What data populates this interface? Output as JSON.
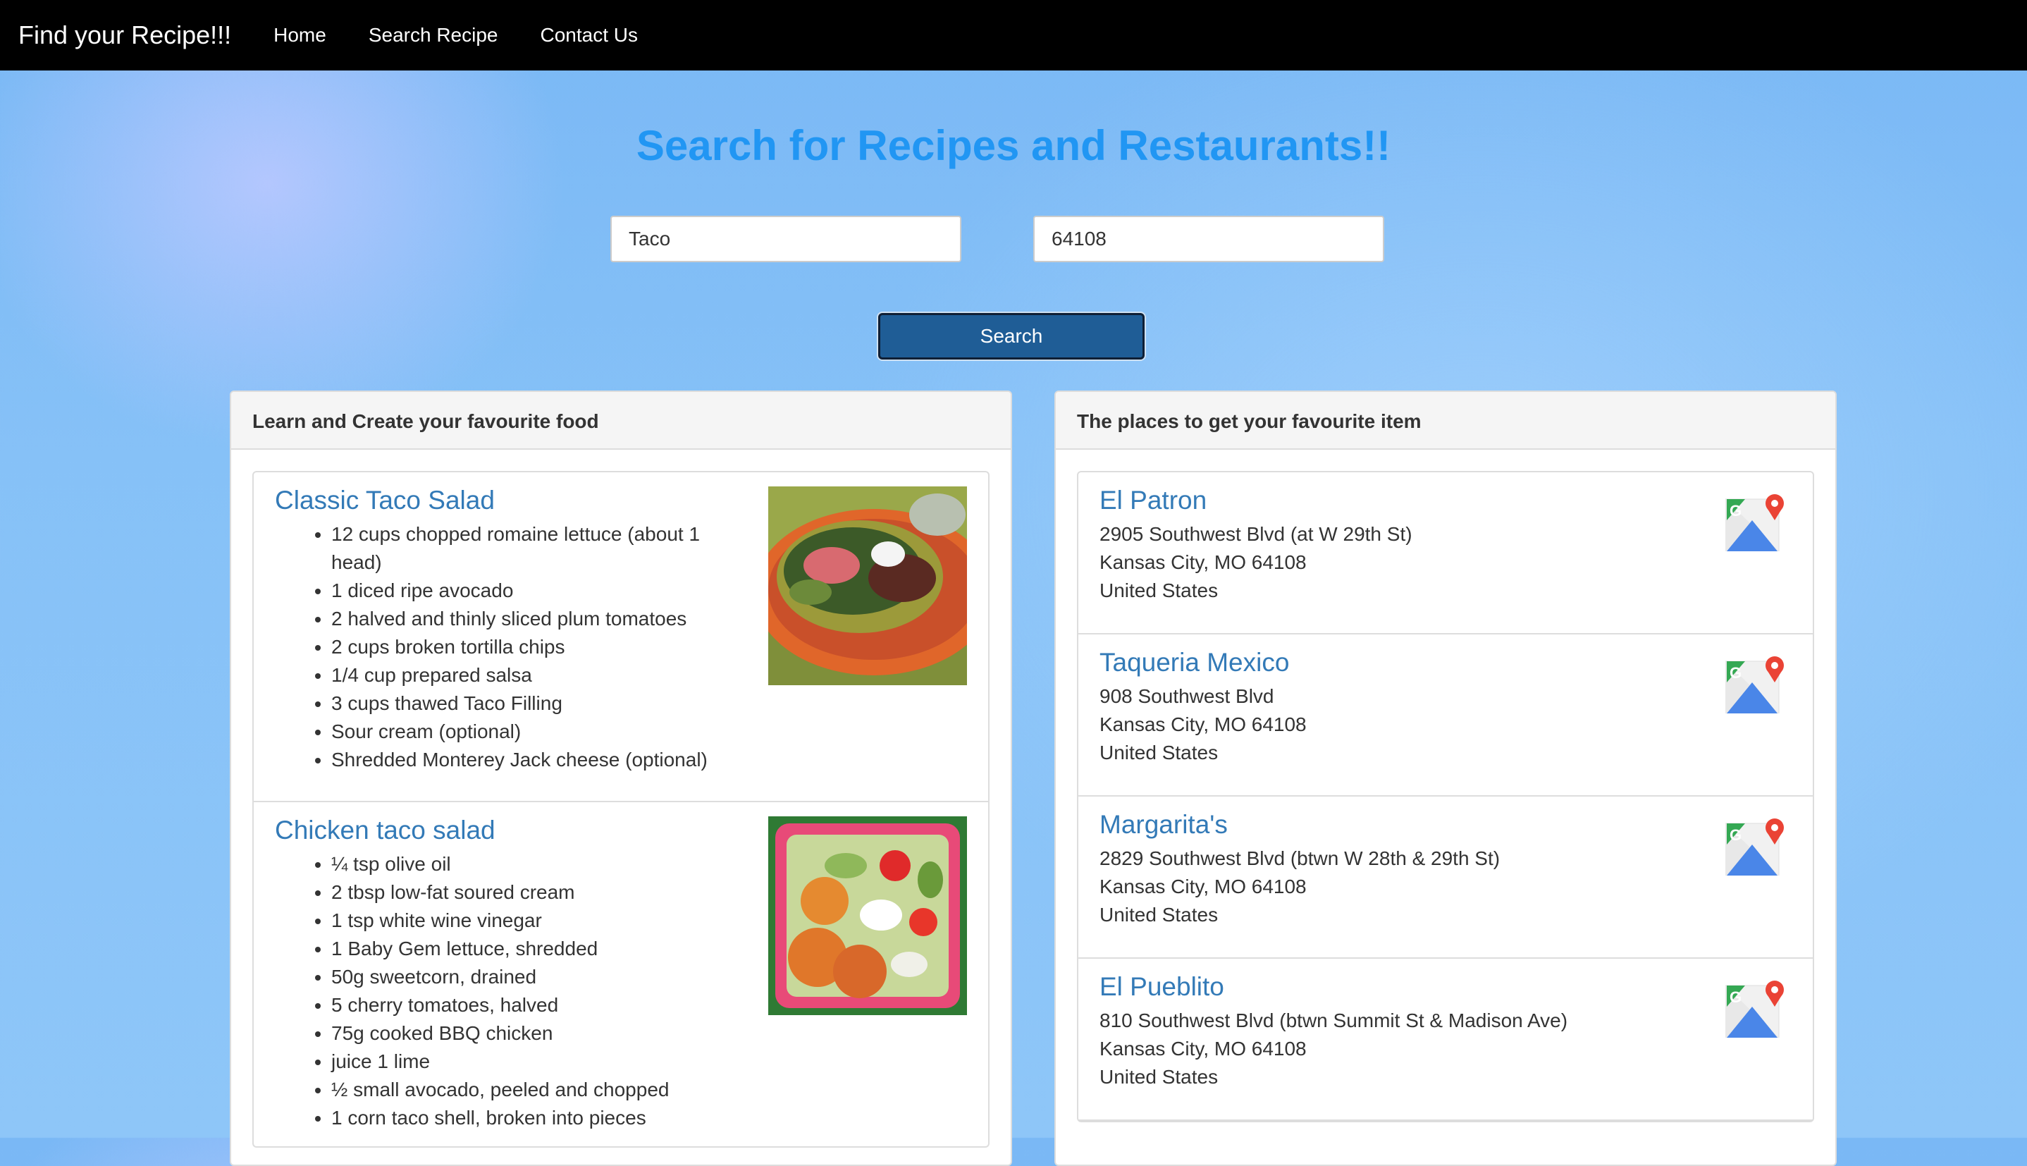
{
  "nav": {
    "brand": "Find your Recipe!!!",
    "links": [
      "Home",
      "Search Recipe",
      "Contact Us"
    ]
  },
  "search": {
    "heading": "Search for Recipes and Restaurants!!",
    "query_value": "Taco",
    "zip_value": "64108",
    "button_label": "Search"
  },
  "recipes_panel": {
    "title": "Learn and Create your favourite food",
    "recipes": [
      {
        "name": "Classic Taco Salad",
        "ingredients": [
          "12 cups chopped romaine lettuce (about 1 head)",
          "1 diced ripe avocado",
          "2 halved and thinly sliced plum tomatoes",
          "2 cups broken tortilla chips",
          "1/4 cup prepared salsa",
          "3 cups thawed Taco Filling",
          "Sour cream (optional)",
          "Shredded Monterey Jack cheese (optional)"
        ]
      },
      {
        "name": "Chicken taco salad",
        "ingredients": [
          "¼ tsp olive oil",
          "2 tbsp low-fat soured cream",
          "1 tsp white wine vinegar",
          "1 Baby Gem lettuce, shredded",
          "50g sweetcorn, drained",
          "5 cherry tomatoes, halved",
          "75g cooked BBQ chicken",
          "juice 1 lime",
          "½ small avocado, peeled and chopped",
          "1 corn taco shell, broken into pieces"
        ]
      }
    ]
  },
  "places_panel": {
    "title": "The places to get your favourite item",
    "places": [
      {
        "name": "El Patron",
        "street": "2905 Southwest Blvd (at W 29th St)",
        "city": "Kansas City, MO 64108",
        "country": "United States",
        "icon": "google-maps-icon"
      },
      {
        "name": "Taqueria Mexico",
        "street": "908 Southwest Blvd",
        "city": "Kansas City, MO 64108",
        "country": "United States",
        "icon": "google-maps-icon"
      },
      {
        "name": "Margarita's",
        "street": "2829 Southwest Blvd (btwn W 28th & 29th St)",
        "city": "Kansas City, MO 64108",
        "country": "United States",
        "icon": "google-maps-icon"
      },
      {
        "name": "El Pueblito",
        "street": "810 Southwest Blvd (btwn Summit St & Madison Ave)",
        "city": "Kansas City, MO 64108",
        "country": "United States",
        "icon": "google-maps-icon"
      }
    ]
  },
  "colors": {
    "navbar": "#000000",
    "heading": "#2196f3",
    "link": "#337ab7",
    "button": "#1f5d96"
  }
}
